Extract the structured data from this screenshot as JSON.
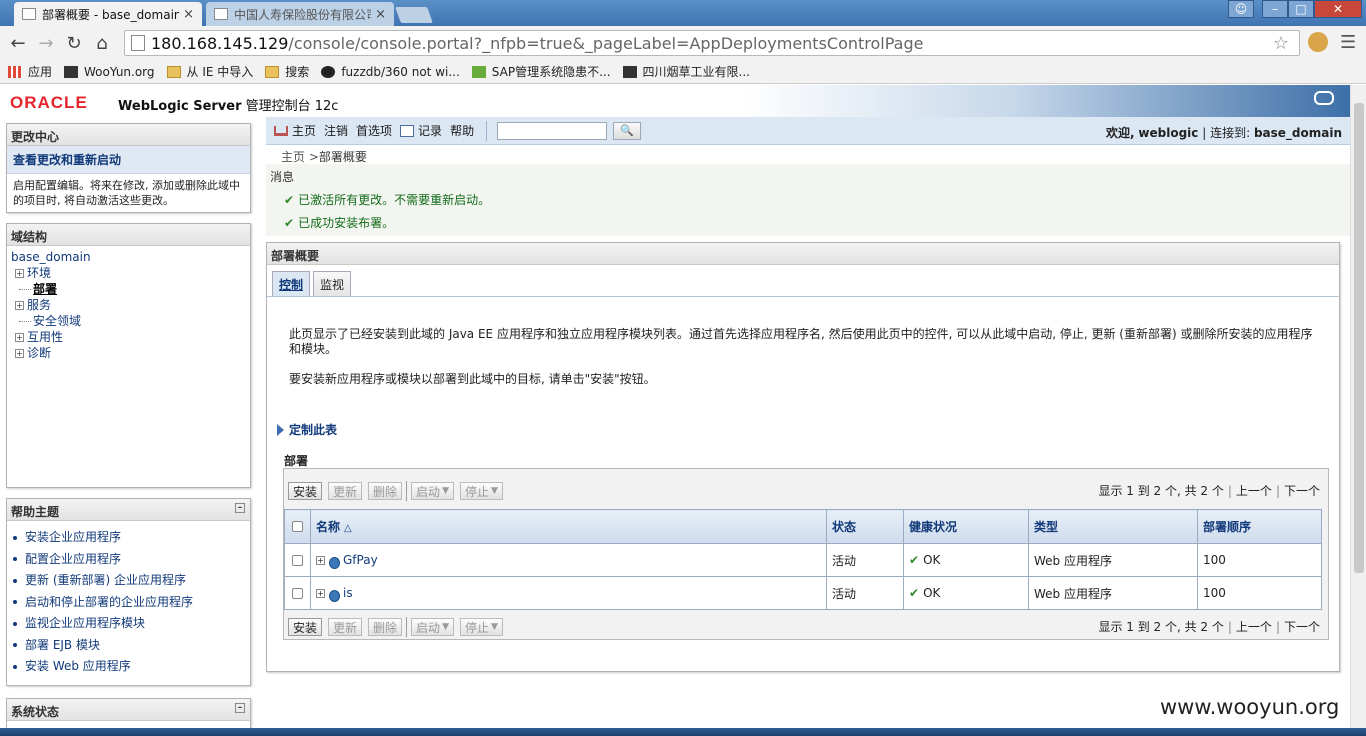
{
  "browser": {
    "tabs": [
      {
        "title": "部署概要 - base_domain",
        "active": true
      },
      {
        "title": "中国人寿保险股份有限公司",
        "active": false
      }
    ],
    "url_host": "180.168.145.129",
    "url_path": "/console/console.portal?_nfpb=true&_pageLabel=AppDeploymentsControlPage",
    "bookmarks": [
      "应用",
      "WooYun.org",
      "从 IE 中导入",
      "搜索",
      "fuzzdb/360 not wi...",
      "SAP管理系统隐患不...",
      "四川烟草工业有限..."
    ]
  },
  "header": {
    "logo": "ORACLE",
    "product_bold": "WebLogic Server",
    "product_rest": " 管理控制台 12c"
  },
  "change_center": {
    "title": "更改中心",
    "link": "查看更改和重新启动",
    "text": "启用配置编辑。将来在修改, 添加或删除此域中的项目时, 将自动激活这些更改。"
  },
  "domain_structure": {
    "title": "域结构",
    "root": "base_domain",
    "items": [
      "环境",
      "部署",
      "服务",
      "安全领域",
      "互用性",
      "诊断"
    ]
  },
  "help_topics": {
    "title": "帮助主题",
    "items": [
      "安装企业应用程序",
      "配置企业应用程序",
      "更新 (重新部署) 企业应用程序",
      "启动和停止部署的企业应用程序",
      "监视企业应用程序模块",
      "部署 EJB 模块",
      "安装 Web 应用程序"
    ]
  },
  "system_status": {
    "title": "系统状态"
  },
  "toolbar": {
    "home": "主页",
    "logout": "注销",
    "prefs": "首选项",
    "record": "记录",
    "help": "帮助",
    "welcome_label": "欢迎,",
    "user": "weblogic",
    "connected_label": "连接到:",
    "domain": "base_domain"
  },
  "breadcrumb": {
    "home": "主页",
    "sep": " >",
    "current": "部署概要"
  },
  "messages": {
    "title": "消息",
    "items": [
      "已激活所有更改。不需要重新启动。",
      "已成功安装布署。"
    ]
  },
  "summary": {
    "title": "部署概要",
    "tabs": [
      "控制",
      "监视"
    ],
    "intro1": "此页显示了已经安装到此域的 Java EE 应用程序和独立应用程序模块列表。通过首先选择应用程序名, 然后使用此页中的控件, 可以从此域中启动, 停止, 更新 (重新部署) 或删除所安装的应用程序和模块。",
    "intro2": "要安装新应用程序或模块以部署到此域中的目标, 请单击\"安装\"按钮。",
    "customize": "定制此表",
    "deploy_title": "部署"
  },
  "table": {
    "buttons": {
      "install": "安装",
      "update": "更新",
      "delete": "删除",
      "start": "启动",
      "stop": "停止"
    },
    "pager": {
      "text": "显示 1 到 2 个, 共 2 个",
      "prev": "上一个",
      "next": "下一个"
    },
    "headers": {
      "name": "名称",
      "state": "状态",
      "health": "健康状况",
      "type": "类型",
      "order": "部署顺序"
    },
    "rows": [
      {
        "name": "GfPay",
        "state": "活动",
        "health": "OK",
        "type": "Web 应用程序",
        "order": "100"
      },
      {
        "name": "is",
        "state": "活动",
        "health": "OK",
        "type": "Web 应用程序",
        "order": "100"
      }
    ]
  },
  "watermark": "www.wooyun.org"
}
